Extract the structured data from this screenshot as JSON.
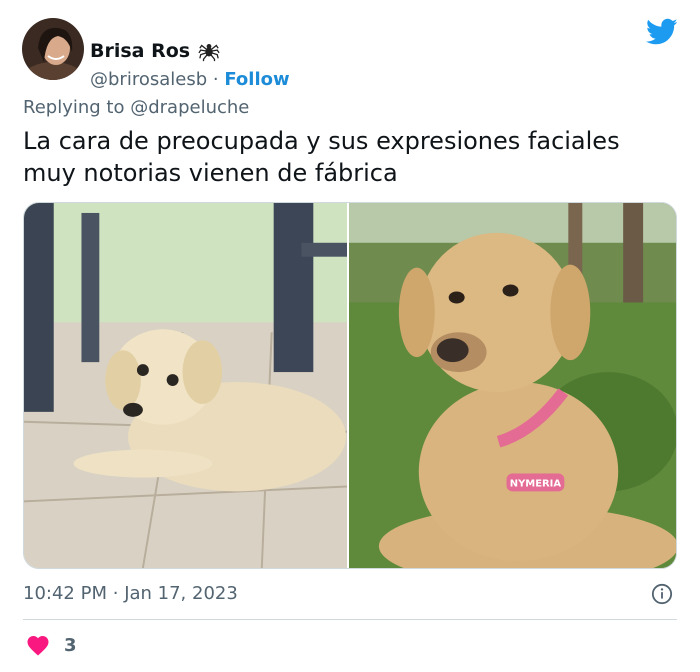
{
  "author": {
    "display_name": "Brisa Ros",
    "handle": "@brirosalesb",
    "separator": "·",
    "follow_label": "Follow",
    "emoji_icon": "spider-icon"
  },
  "reply": {
    "prefix": "Replying to",
    "mention": "@drapeluche"
  },
  "tweet": {
    "text": "La cara de preocupada y sus expresiones faciales muy notorias vienen de fábrica"
  },
  "media": {
    "photos": [
      {
        "subject": "puppy-lying-on-tile-floor"
      },
      {
        "subject": "adult-dog-on-grass",
        "tag_text": "NYMERIA"
      }
    ]
  },
  "meta": {
    "time": "10:42 PM",
    "separator": "·",
    "date": "Jan 17, 2023"
  },
  "engagement": {
    "like_count": "3"
  },
  "colors": {
    "twitter_blue": "#1d9bf0",
    "heart_red": "#f91880",
    "secondary_text": "#536471"
  }
}
